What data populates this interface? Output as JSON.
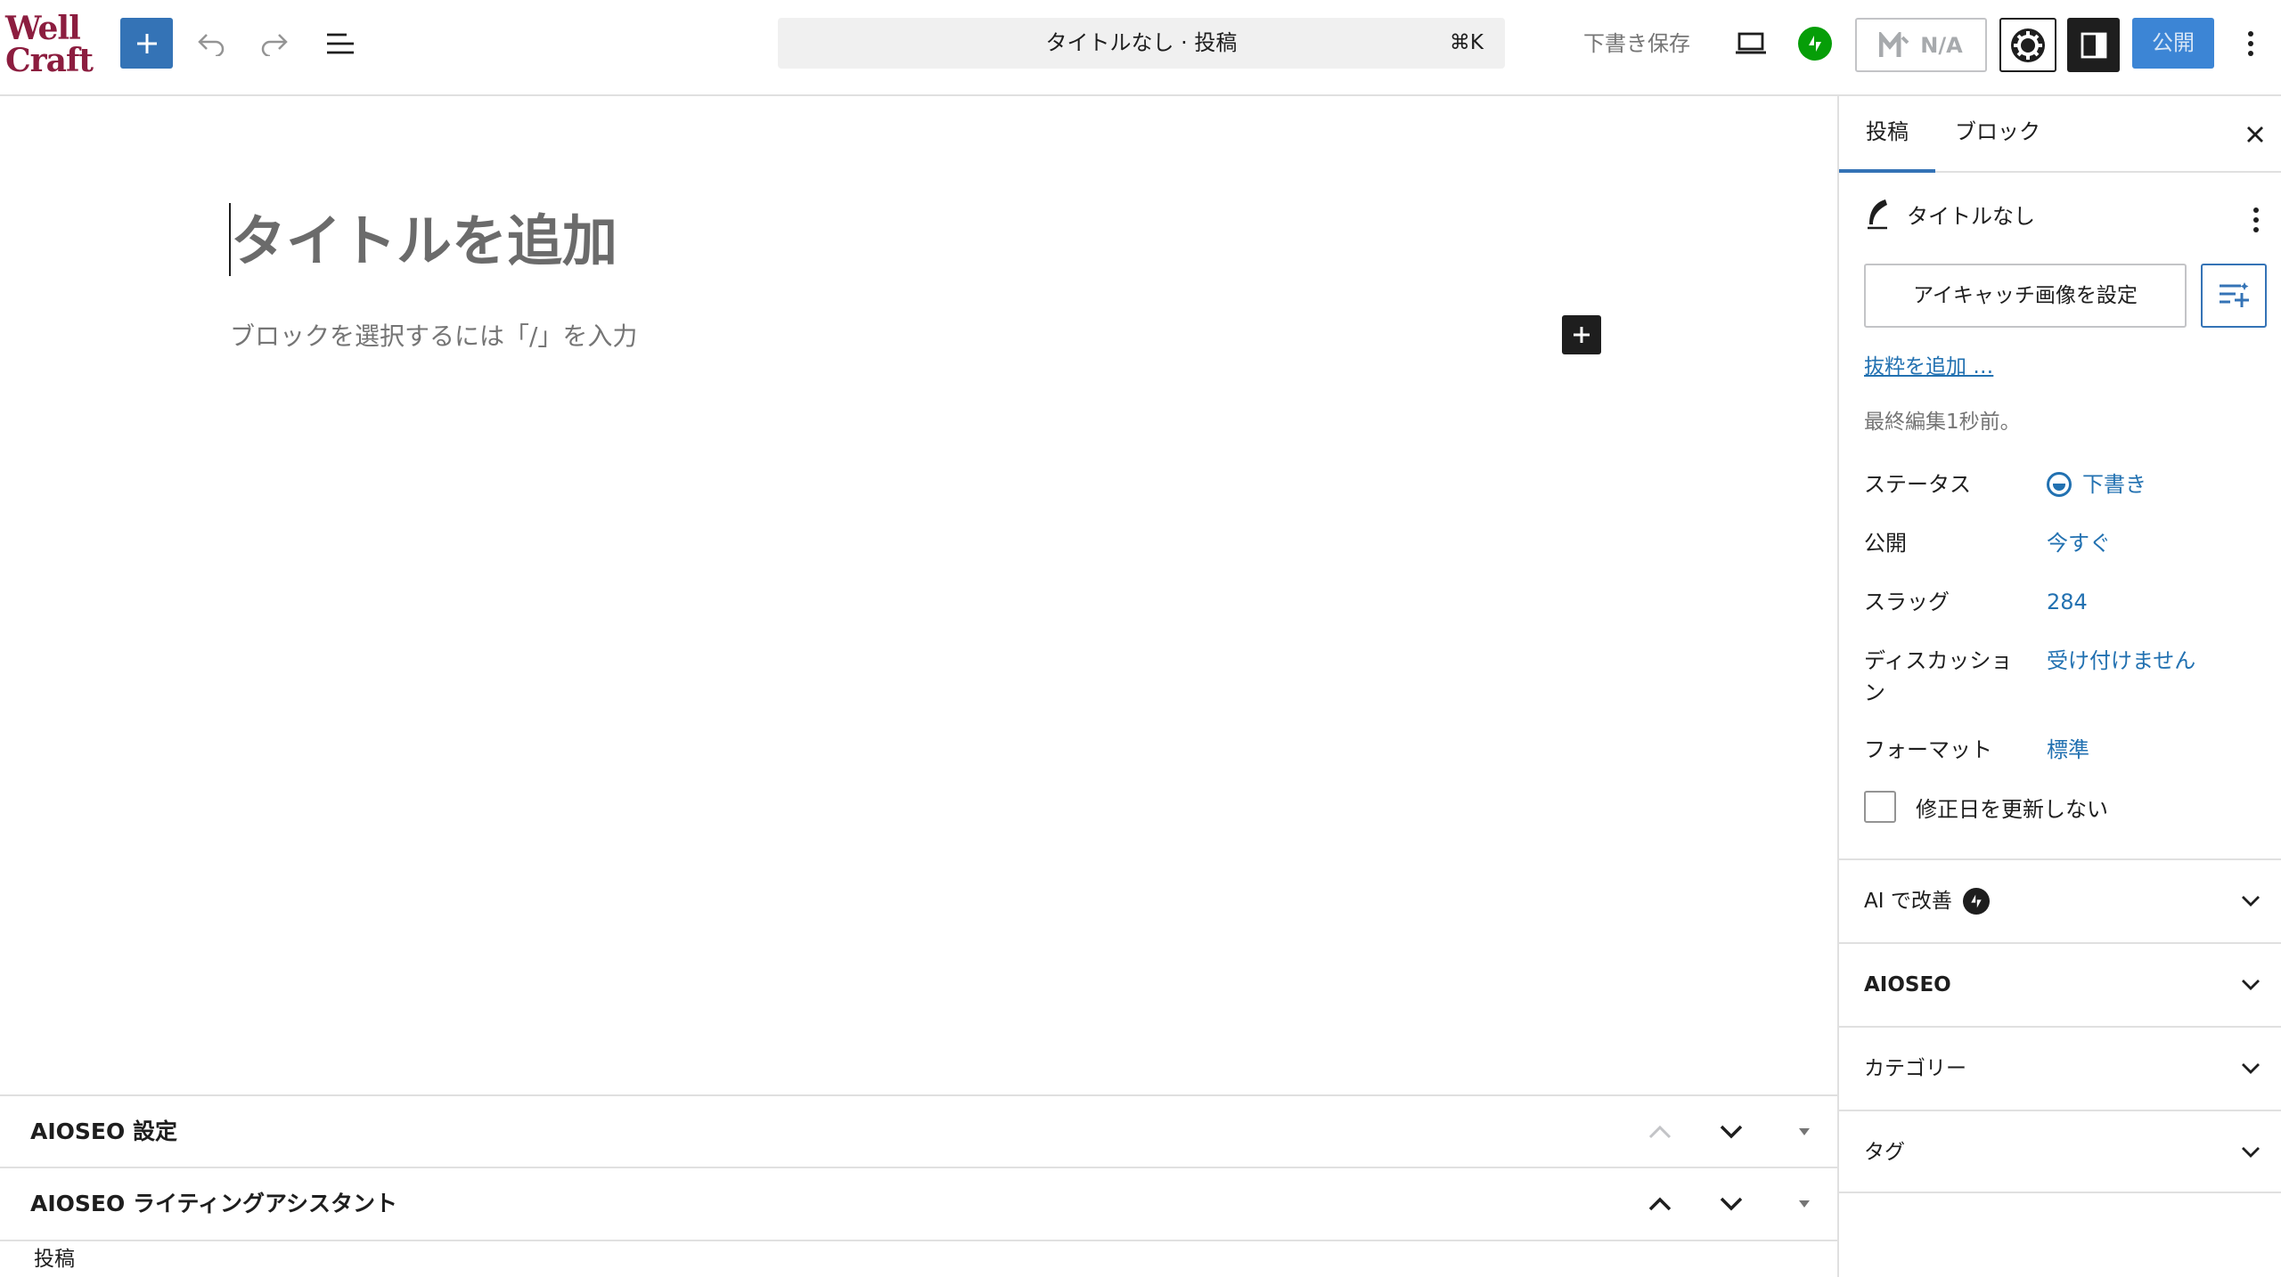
{
  "app": {
    "logo_line1": "Well",
    "logo_line2": "Craft"
  },
  "toolbar": {
    "command_title": "タイトルなし · 投稿",
    "command_shortcut": "⌘K",
    "save_draft": "下書き保存",
    "seo_score": "N/A",
    "publish": "公開",
    "icons": [
      "plus-icon",
      "undo-icon",
      "redo-icon",
      "list-view-icon",
      "desktop-preview-icon",
      "jetpack-icon",
      "seo-score-icon",
      "aioseo-icon",
      "sidebar-toggle-icon",
      "more-vertical-icon"
    ]
  },
  "editor": {
    "title_placeholder": "タイトルを追加",
    "block_placeholder": "ブロックを選択するには「/」を入力"
  },
  "metaboxes": [
    {
      "title": "AIOSEO 設定"
    },
    {
      "title": "AIOSEO ライティングアシスタント"
    }
  ],
  "footer": {
    "breadcrumb": "投稿"
  },
  "sidebar": {
    "tabs": [
      {
        "label": "投稿"
      },
      {
        "label": "ブロック"
      }
    ],
    "active_tab": "投稿",
    "post_title": "タイトルなし",
    "featured_image_button": "アイキャッチ画像を設定",
    "excerpt_link": "抜粋を追加 …",
    "last_edited": "最終編集1秒前。",
    "meta": [
      {
        "label": "ステータス",
        "value": "下書き"
      },
      {
        "label": "公開",
        "value": "今すぐ"
      },
      {
        "label": "スラッグ",
        "value": "284"
      },
      {
        "label": "ディスカッショ\nン",
        "value": "受け付けません"
      },
      {
        "label": "フォーマット",
        "value": "標準"
      }
    ],
    "checkbox_label": "修正日を更新しない",
    "checkbox_checked": false,
    "panels": [
      {
        "title": "AI で改善"
      },
      {
        "title": "AIOSEO"
      },
      {
        "title": "カテゴリー"
      },
      {
        "title": "タグ"
      }
    ]
  },
  "colors": {
    "accent": "#3473b6",
    "link": "#2271b1",
    "brand": "#8c1d3f",
    "jetpack": "#069e08"
  }
}
